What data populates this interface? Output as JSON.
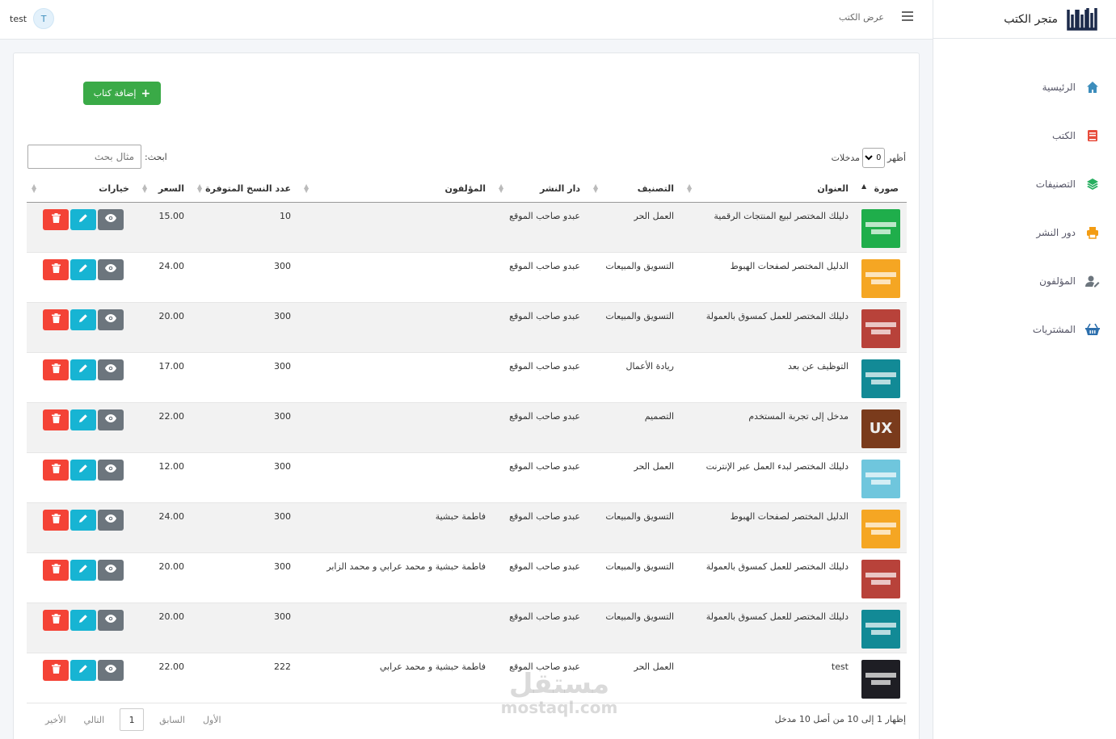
{
  "brand": {
    "name": "متجر الكتب"
  },
  "sidebar": {
    "items": [
      {
        "label": "الرئيسية",
        "icon": "home-icon",
        "color": "#3c8dbc"
      },
      {
        "label": "الكتب",
        "icon": "book-icon",
        "color": "#e74c3c"
      },
      {
        "label": "التصنيفات",
        "icon": "layers-icon",
        "color": "#27ae60"
      },
      {
        "label": "دور النشر",
        "icon": "printer-icon",
        "color": "#f39c12"
      },
      {
        "label": "المؤلفون",
        "icon": "user-edit-icon",
        "color": "#6c757d"
      },
      {
        "label": "المشتريات",
        "icon": "basket-icon",
        "color": "#2c6fad"
      }
    ]
  },
  "topbar": {
    "title": "عرض الكتب",
    "user_name": "test",
    "avatar_letter": "T"
  },
  "toolbar": {
    "add_label": "إضافة كتاب"
  },
  "table_controls": {
    "show_label": "أظهر",
    "entries_label": "مدخلات",
    "page_size": "10",
    "search_label": "ابحث:",
    "search_placeholder": "مثال بحث"
  },
  "columns": [
    "صورة",
    "العنوان",
    "التصنيف",
    "دار النشر",
    "المؤلفون",
    "عدد النسخ المتوفرة",
    "السعر",
    "خيارات"
  ],
  "rows": [
    {
      "title": "دليلك المختصر لبيع المنتجات الرقمية",
      "category": "العمل الحر",
      "publisher": "عبدو صاحب الموقع",
      "authors": "",
      "copies": "10",
      "price": "15.00",
      "cover_color": "#1fae4b",
      "cover_text": ""
    },
    {
      "title": "الدليل المختصر لصفحات الهبوط",
      "category": "التسويق والمبيعات",
      "publisher": "عبدو صاحب الموقع",
      "authors": "",
      "copies": "300",
      "price": "24.00",
      "cover_color": "#f5a623",
      "cover_text": ""
    },
    {
      "title": "دليلك المختصر للعمل كمسوق بالعمولة",
      "category": "التسويق والمبيعات",
      "publisher": "عبدو صاحب الموقع",
      "authors": "",
      "copies": "300",
      "price": "20.00",
      "cover_color": "#b8423a",
      "cover_text": ""
    },
    {
      "title": "التوظيف عن بعد",
      "category": "ريادة الأعمال",
      "publisher": "عبدو صاحب الموقع",
      "authors": "",
      "copies": "300",
      "price": "17.00",
      "cover_color": "#128a96",
      "cover_text": ""
    },
    {
      "title": "مدخل إلى تجربة المستخدم",
      "category": "التصميم",
      "publisher": "عبدو صاحب الموقع",
      "authors": "",
      "copies": "300",
      "price": "22.00",
      "cover_color": "#7a3b1c",
      "cover_text": "UX"
    },
    {
      "title": "دليلك المختصر لبدء العمل عبر الإنترنت",
      "category": "العمل الحر",
      "publisher": "عبدو صاحب الموقع",
      "authors": "",
      "copies": "300",
      "price": "12.00",
      "cover_color": "#6fc6dd",
      "cover_text": ""
    },
    {
      "title": "الدليل المختصر لصفحات الهبوط",
      "category": "التسويق والمبيعات",
      "publisher": "عبدو صاحب الموقع",
      "authors": "فاطمة حبشية",
      "copies": "300",
      "price": "24.00",
      "cover_color": "#f5a623",
      "cover_text": ""
    },
    {
      "title": "دليلك المختصر للعمل كمسوق بالعمولة",
      "category": "التسويق والمبيعات",
      "publisher": "عبدو صاحب الموقع",
      "authors": "فاطمة حبشية و محمد عرابي و محمد الزابر",
      "copies": "300",
      "price": "20.00",
      "cover_color": "#b8423a",
      "cover_text": ""
    },
    {
      "title": "دليلك المختصر للعمل كمسوق بالعمولة",
      "category": "التسويق والمبيعات",
      "publisher": "عبدو صاحب الموقع",
      "authors": "",
      "copies": "300",
      "price": "20.00",
      "cover_color": "#128a96",
      "cover_text": ""
    },
    {
      "title": "test",
      "category": "العمل الحر",
      "publisher": "عبدو صاحب الموقع",
      "authors": "فاطمة حبشية و محمد عرابي",
      "copies": "222",
      "price": "22.00",
      "cover_color": "#1e1e24",
      "cover_text": ""
    }
  ],
  "footer": {
    "info": "إظهار 1 إلى 10 من أصل 10 مدخل",
    "first": "الأول",
    "previous": "السابق",
    "current": "1",
    "next": "التالي",
    "last": "الأخير"
  },
  "watermark": {
    "line1": "مستقل",
    "line2": "mostaql.com"
  }
}
